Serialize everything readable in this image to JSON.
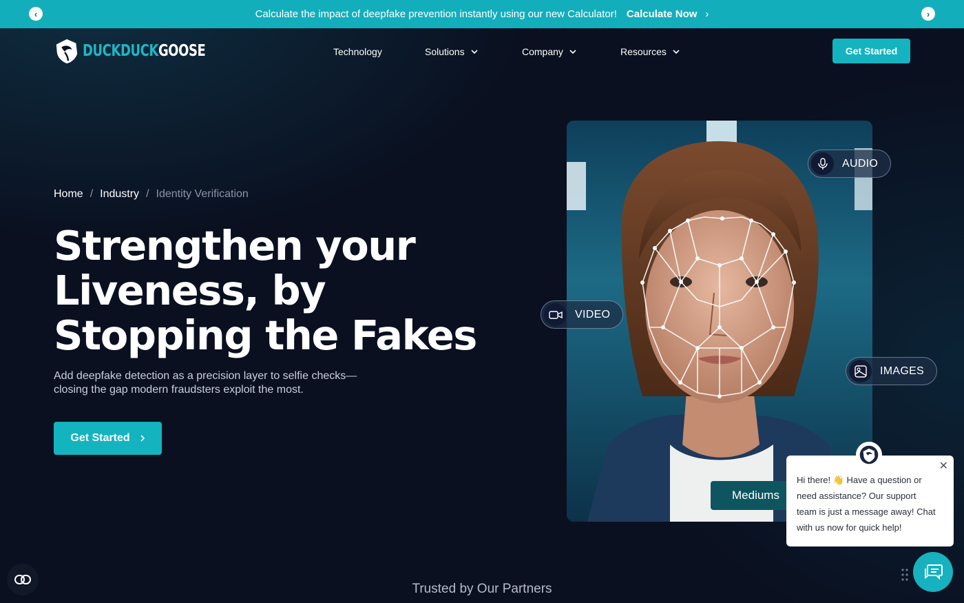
{
  "announcement": {
    "message": "Calculate the impact of deepfake prevention instantly using our new Calculator!",
    "cta": "Calculate Now",
    "prev_icon": "chevron-left-icon",
    "next_icon": "chevron-right-icon"
  },
  "header": {
    "logo_part1": "DUCKDUCK",
    "logo_part2": "GOOSE",
    "nav": [
      {
        "label": "Technology"
      },
      {
        "label": "Solutions"
      },
      {
        "label": "Company"
      },
      {
        "label": "Resources"
      }
    ],
    "cta": "Get Started"
  },
  "hero": {
    "breadcrumb": [
      "Home",
      "Industry",
      "Identity Verification"
    ],
    "breadcrumb_sep": "/",
    "title_lines": [
      "Strengthen your",
      "Liveness, by",
      "Stopping the Fakes"
    ],
    "subtitle_lines": [
      "Add deepfake detection as a precision layer to selfie checks—",
      "closing the gap modern fraudsters exploit the most."
    ],
    "cta": "Get Started"
  },
  "visual": {
    "chips": {
      "audio": "AUDIO",
      "video": "VIDEO",
      "images": "IMAGES"
    },
    "mediums_label": "Mediums"
  },
  "chat": {
    "message_lines": [
      "Hi there! 👋 Have a question or",
      "need assistance? Our support",
      "team is just a message away! Chat",
      "with us now for quick help!"
    ],
    "close": "✕"
  },
  "partners_heading": "Trusted by Our Partners",
  "colors": {
    "accent": "#14b3c0",
    "background": "#0a1020",
    "announcement_bg": "#13aebc"
  }
}
